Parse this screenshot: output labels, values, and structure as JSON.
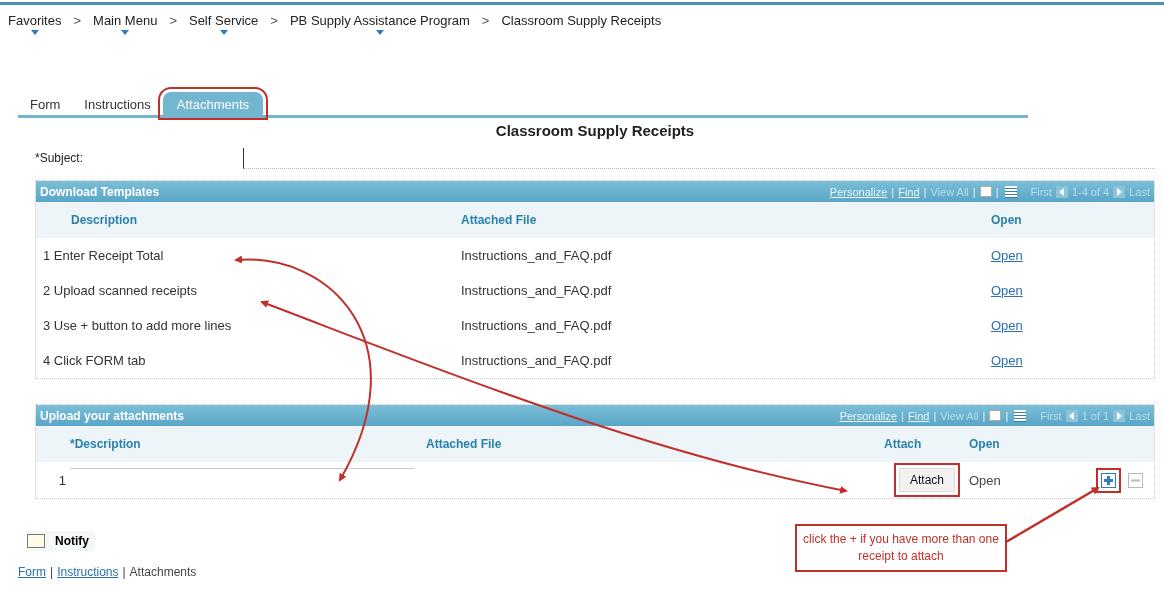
{
  "breadcrumb": {
    "separator": ">",
    "items": [
      {
        "label": "Favorites",
        "dropdown": true
      },
      {
        "label": "Main Menu",
        "dropdown": true
      },
      {
        "label": "Self Service",
        "dropdown": true
      },
      {
        "label": "PB Supply Assistance Program",
        "dropdown": true
      },
      {
        "label": "Classroom Supply Receipts",
        "dropdown": false
      }
    ]
  },
  "tabs": [
    {
      "label": "Form",
      "selected": false,
      "highlighted": false
    },
    {
      "label": "Instructions",
      "selected": false,
      "highlighted": false
    },
    {
      "label": "Attachments",
      "selected": true,
      "highlighted": true
    }
  ],
  "page_title": "Classroom Supply Receipts",
  "subject": {
    "label": "*Subject:"
  },
  "templates_grid": {
    "title": "Download Templates",
    "toolbar": [
      {
        "kind": "link",
        "text": "Personalize"
      },
      {
        "kind": "sep",
        "text": "|"
      },
      {
        "kind": "link",
        "text": "Find"
      },
      {
        "kind": "sep",
        "text": "|"
      },
      {
        "kind": "off",
        "text": "View All"
      },
      {
        "kind": "sep",
        "text": "|"
      },
      {
        "kind": "popout"
      },
      {
        "kind": "sep",
        "text": "|"
      },
      {
        "kind": "spreadsheet"
      },
      {
        "kind": "off",
        "text": "First"
      },
      {
        "kind": "prev"
      },
      {
        "kind": "off",
        "text": "1-4 of 4"
      },
      {
        "kind": "next"
      },
      {
        "kind": "off",
        "text": "Last"
      }
    ],
    "columns": [
      "Description",
      "Attached File",
      "Open"
    ],
    "rows": [
      {
        "description": "1 Enter Receipt Total",
        "attached_file": "Instructions_and_FAQ.pdf",
        "open": "Open"
      },
      {
        "description": "2 Upload scanned receipts",
        "attached_file": "Instructions_and_FAQ.pdf",
        "open": "Open"
      },
      {
        "description": "3 Use + button to add more lines",
        "attached_file": "Instructions_and_FAQ.pdf",
        "open": "Open"
      },
      {
        "description": "4 Click FORM tab",
        "attached_file": "Instructions_and_FAQ.pdf",
        "open": "Open"
      }
    ]
  },
  "upload_grid": {
    "title": "Upload your attachments",
    "toolbar": [
      {
        "kind": "link",
        "text": "Personalize"
      },
      {
        "kind": "sep",
        "text": "|"
      },
      {
        "kind": "link",
        "text": "Find"
      },
      {
        "kind": "sep",
        "text": "|"
      },
      {
        "kind": "off",
        "text": "View All"
      },
      {
        "kind": "sep",
        "text": "|"
      },
      {
        "kind": "popout"
      },
      {
        "kind": "sep",
        "text": "|"
      },
      {
        "kind": "spreadsheet"
      },
      {
        "kind": "off",
        "text": "First"
      },
      {
        "kind": "prev"
      },
      {
        "kind": "off",
        "text": "1 of 1"
      },
      {
        "kind": "next"
      },
      {
        "kind": "off",
        "text": "Last"
      }
    ],
    "columns": [
      "*Description",
      "Attached File",
      "Attach",
      "Open"
    ],
    "rows": [
      {
        "number": "1",
        "attach": {
          "label": "Attach",
          "highlighted": true
        },
        "open": {
          "label": "Open",
          "disabled": true
        },
        "actions": [
          {
            "kind": "add",
            "disabled": false,
            "highlighted": true
          },
          {
            "kind": "delete",
            "disabled": true,
            "highlighted": false
          }
        ]
      }
    ]
  },
  "notify": {
    "label": "Notify"
  },
  "footer_links": {
    "separator": "|",
    "items": [
      {
        "label": "Form",
        "link": true
      },
      {
        "label": "Instructions",
        "link": true
      },
      {
        "label": "Attachments",
        "link": false
      }
    ]
  },
  "callout": "click the + if you have more than one receipt to attach"
}
